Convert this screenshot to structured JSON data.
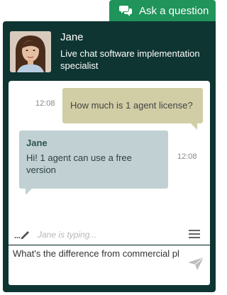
{
  "ask_tab": {
    "label": "Ask a question",
    "icon": "chat-bubbles-icon",
    "color": "#20945a"
  },
  "agent": {
    "name": "Jane",
    "title": "Live chat software implementation specialist",
    "avatar_icon": "agent-avatar-photo"
  },
  "messages": [
    {
      "from": "visitor",
      "time": "12:08",
      "text": "How much is 1 agent license?"
    },
    {
      "from": "agent",
      "sender": "Jane",
      "time": "12:08",
      "text": "Hi! 1 agent can use a free version"
    }
  ],
  "typing": {
    "text": "Jane is typing...",
    "icon": "pencil-dots-icon"
  },
  "menu": {
    "icon": "hamburger-menu-icon"
  },
  "input": {
    "value": "What's the difference from commercial pl",
    "placeholder": ""
  },
  "send": {
    "icon": "send-arrow-icon"
  },
  "colors": {
    "widget_bg": "#0e3531",
    "visitor_bubble": "#d1cda5",
    "agent_bubble": "#c1d1d3",
    "accent": "#20945a"
  }
}
